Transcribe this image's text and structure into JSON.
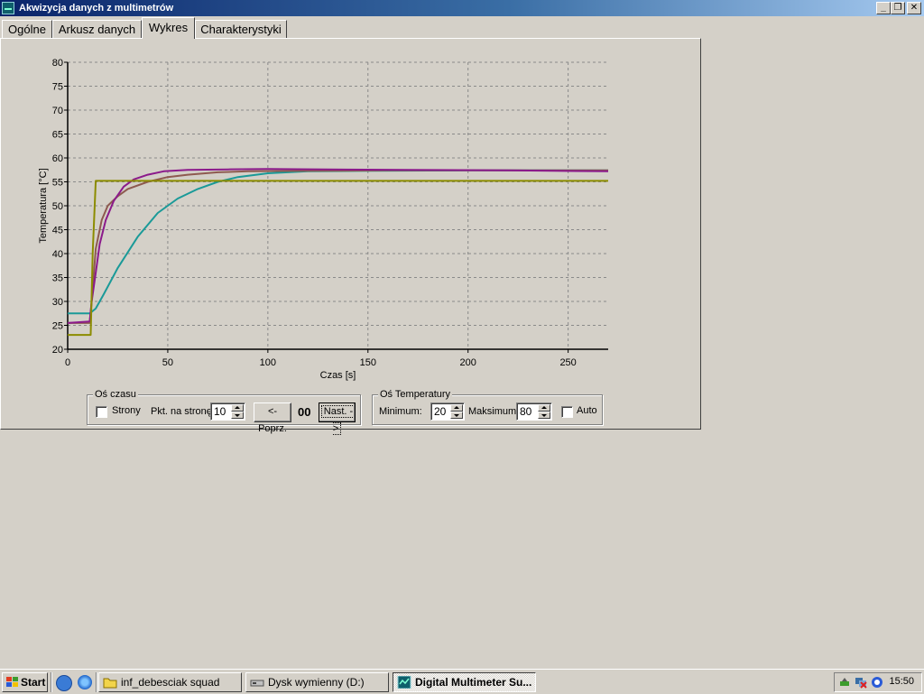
{
  "window": {
    "title": "Akwizycja danych z multimetrów",
    "minimize_label": "_",
    "restore_label": "❐",
    "close_label": "✕"
  },
  "tabs": [
    {
      "label": "Ogólne"
    },
    {
      "label": "Arkusz danych"
    },
    {
      "label": "Wykres",
      "active": true
    },
    {
      "label": "Charakterystyki"
    }
  ],
  "chart_data": {
    "type": "line",
    "xlabel": "Czas [s]",
    "ylabel": "Temperatura [°C]",
    "xlim": [
      0,
      270
    ],
    "ylim": [
      20,
      80
    ],
    "xticks": [
      0,
      50,
      100,
      150,
      200,
      250
    ],
    "yticks": [
      20,
      25,
      30,
      35,
      40,
      45,
      50,
      55,
      60,
      65,
      70,
      75,
      80
    ],
    "grid": true,
    "series": [
      {
        "color": "#1a9a98",
        "x": [
          0,
          11,
          14,
          18,
          25,
          35,
          45,
          55,
          65,
          75,
          85,
          100,
          120,
          150,
          200,
          270
        ],
        "values": [
          27.5,
          27.5,
          28.5,
          31.5,
          37,
          43.5,
          48.5,
          51.5,
          53.5,
          55,
          56,
          56.8,
          57.2,
          57.3,
          57.4,
          57.4
        ]
      },
      {
        "color": "#8e5a50",
        "x": [
          0,
          11,
          12,
          14,
          17,
          20,
          25,
          30,
          40,
          50,
          60,
          75,
          90,
          120,
          160,
          220,
          270
        ],
        "values": [
          25.5,
          25.5,
          30,
          41,
          47,
          50,
          52,
          53.5,
          55,
          56,
          56.5,
          57,
          57.2,
          57.3,
          57.4,
          57.4,
          57.4
        ]
      },
      {
        "color": "#8b1a8b",
        "x": [
          0,
          11,
          12,
          14,
          16,
          19,
          23,
          28,
          33,
          40,
          48,
          60,
          80,
          100,
          130,
          170,
          220,
          270
        ],
        "values": [
          25.5,
          25.8,
          30,
          36,
          42,
          47,
          51,
          54,
          55.5,
          56.5,
          57.2,
          57.5,
          57.6,
          57.7,
          57.6,
          57.5,
          57.4,
          57.2
        ]
      },
      {
        "color": "#8c8c00",
        "x": [
          0,
          11.5,
          12.5,
          14,
          270
        ],
        "values": [
          23,
          23,
          40,
          55.2,
          55.2
        ]
      }
    ]
  },
  "time_axis_group": {
    "label": "Oś czasu",
    "pages_checkbox_label": "Strony",
    "points_per_page_label": "Pkt. na stronę",
    "points_per_page_value": "10",
    "prev_button": "<-Poprz.",
    "page_counter": "00",
    "next_button": "Nast. ->"
  },
  "temp_axis_group": {
    "label": "Oś Temperatury",
    "min_label": "Minimum:",
    "min_value": "20",
    "max_label": "Maksimum:",
    "max_value": "80",
    "auto_label": "Auto"
  },
  "taskbar": {
    "start_label": "Start",
    "tasks": [
      {
        "label": "inf_debesciak squad"
      },
      {
        "label": "Dysk wymienny (D:)"
      },
      {
        "label": "Digital Multimeter Su...",
        "active": true
      }
    ],
    "clock": "15:50"
  }
}
